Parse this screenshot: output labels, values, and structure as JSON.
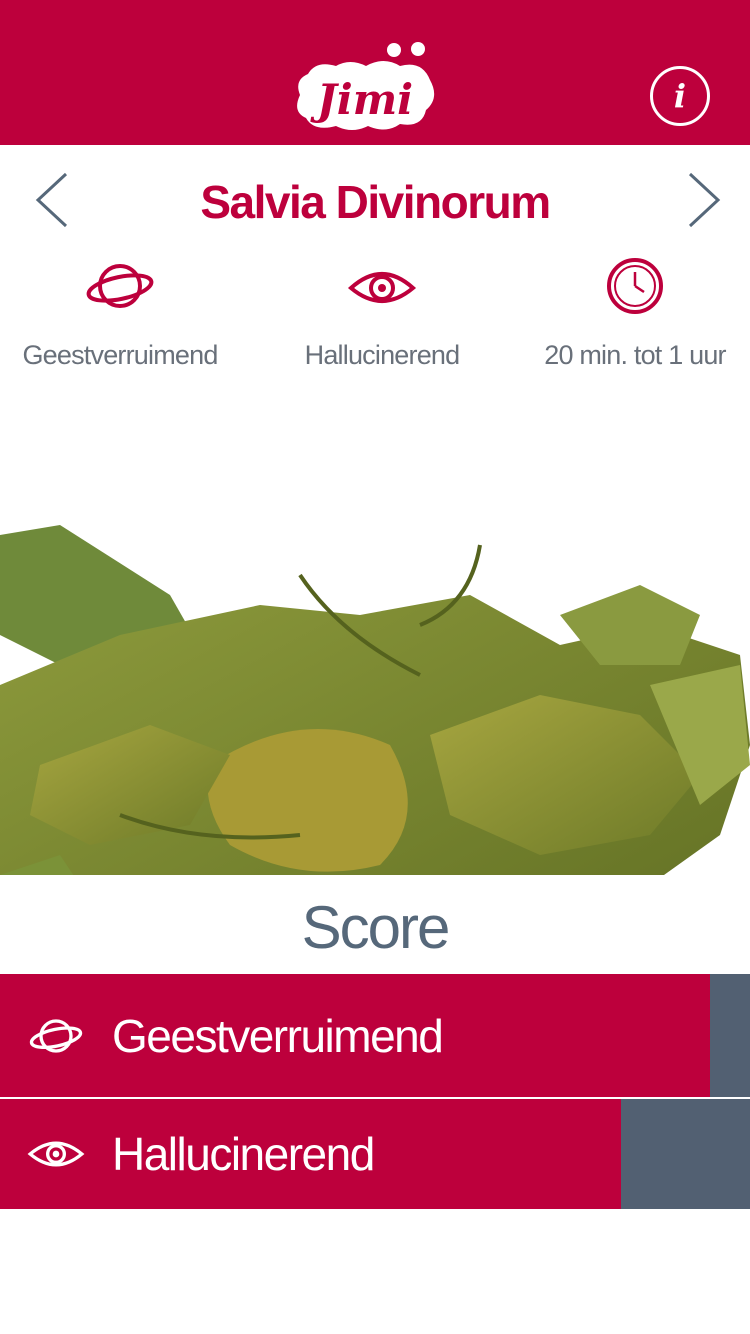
{
  "header": {
    "logo_text": "Jimi",
    "info_label": "i"
  },
  "substance": {
    "title": "Salvia Divinorum",
    "attributes": [
      {
        "label": "Geestverruimend",
        "icon": "planet-icon"
      },
      {
        "label": "Hallucinerend",
        "icon": "eye-icon"
      },
      {
        "label": "20 min. tot 1 uur",
        "icon": "clock-icon"
      }
    ],
    "image": "dried-salvia-leaves"
  },
  "score": {
    "title": "Score",
    "items": [
      {
        "label": "Geestverruimend",
        "icon": "planet-icon",
        "level_percent": 94.7
      },
      {
        "label": "Hallucinerend",
        "icon": "eye-icon",
        "level_percent": 82.8
      }
    ]
  },
  "colors": {
    "brand": "#bd003c",
    "score_track": "#526072",
    "score_title": "#56687a",
    "label_text": "#69707a"
  }
}
